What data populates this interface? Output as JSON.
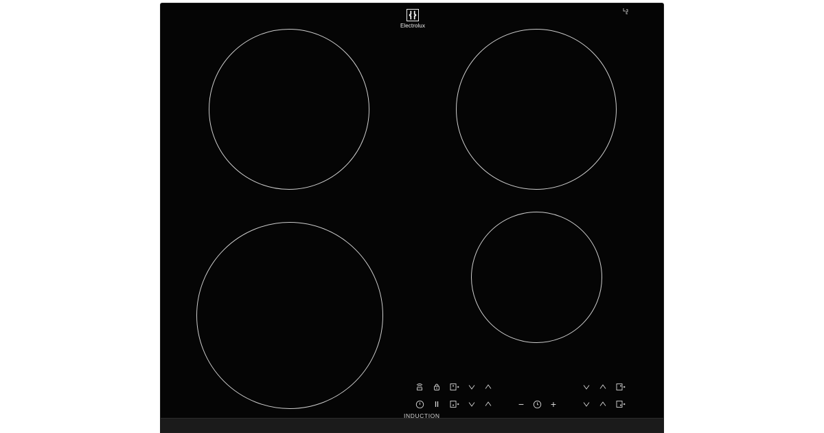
{
  "brand": {
    "name": "Electrolux",
    "logo_icon": "electrolux-logo-icon"
  },
  "cooktop": {
    "type_label": "INDUCTION",
    "colors": {
      "glass": "#050505",
      "ring": "#cfcfcf",
      "frame": "#1b1b1b",
      "background": "#ffffff"
    }
  },
  "cooking_zones": [
    {
      "id": "rear-left"
    },
    {
      "id": "front-left"
    },
    {
      "id": "rear-right"
    },
    {
      "id": "front-right"
    }
  ],
  "controls": {
    "left_row1": [
      "hob2hood-icon",
      "lock-icon",
      "zone-select-icon",
      "chevron-down-icon",
      "chevron-up-icon"
    ],
    "left_row2": [
      "power-icon",
      "pause-icon",
      "zone-select-icon",
      "chevron-down-icon",
      "chevron-up-icon"
    ],
    "timer": {
      "minus_label": "−",
      "plus_label": "+",
      "icon": "timer-icon"
    },
    "right_row1": [
      "chevron-down-icon",
      "chevron-up-icon",
      "zone-select-icon"
    ],
    "right_row2": [
      "chevron-down-icon",
      "chevron-up-icon",
      "zone-select-icon"
    ]
  }
}
